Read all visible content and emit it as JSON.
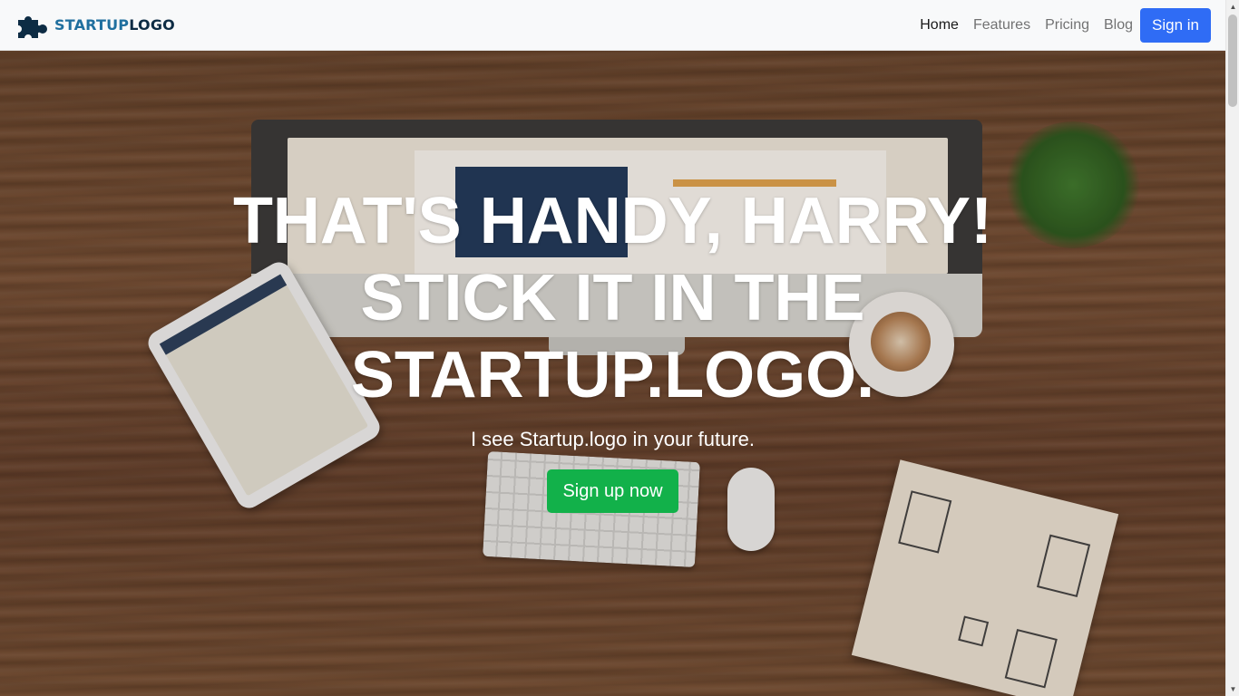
{
  "brand": {
    "name_part1": "STARTUP",
    "name_part2": "LOGO",
    "icon": "puzzle-piece-icon",
    "colors": {
      "primary": "#1f6f9f",
      "dark": "#0d2c44"
    }
  },
  "nav": {
    "items": [
      {
        "label": "Home",
        "active": true
      },
      {
        "label": "Features",
        "active": false
      },
      {
        "label": "Pricing",
        "active": false
      },
      {
        "label": "Blog",
        "active": false
      }
    ],
    "signin_label": "Sign in"
  },
  "hero": {
    "headline_line1": "THAT'S HANDY, HARRY!",
    "headline_line2": "STICK IT IN THE",
    "headline_line3": "STARTUP.LOGO.",
    "subheadline": "I see Startup.logo in your future.",
    "cta_label": "Sign up now",
    "background": "wooden-desk-photo"
  },
  "colors": {
    "signin_button": "#2f6cf5",
    "cta_button": "#12b14a",
    "navbar_bg": "#f8f9fa"
  },
  "scrollbar": {
    "up_icon": "arrow-up-icon",
    "down_icon": "arrow-down-icon"
  }
}
